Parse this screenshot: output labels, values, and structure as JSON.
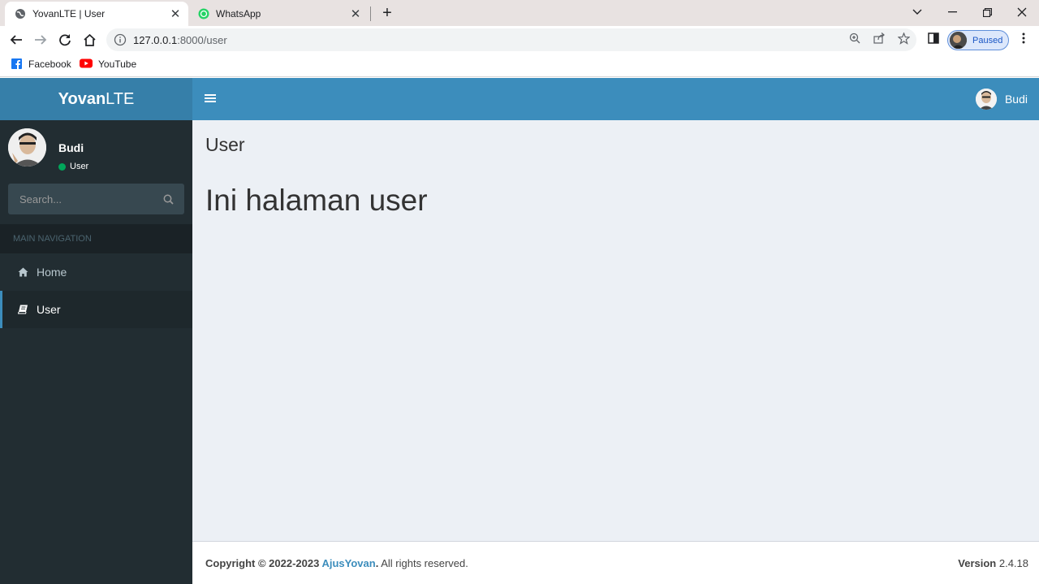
{
  "browser": {
    "tabs": [
      {
        "title": "YovanLTE | User",
        "icon": "globe-icon",
        "active": true
      },
      {
        "title": "WhatsApp",
        "icon": "whatsapp-icon",
        "active": false
      }
    ],
    "url_host": "127.0.0.1",
    "url_path": ":8000/user",
    "profile_label": "Paused",
    "bookmarks": [
      {
        "label": "Facebook",
        "icon": "facebook-icon"
      },
      {
        "label": "YouTube",
        "icon": "youtube-icon"
      }
    ]
  },
  "app": {
    "logo_bold": "Yovan",
    "logo_light": "LTE",
    "header_user": "Budi",
    "colors": {
      "header": "#3c8dbc",
      "logo_bg": "#367fa9",
      "sidebar": "#222d32",
      "content": "#ecf0f5",
      "online": "#00a65a"
    }
  },
  "sidebar": {
    "user_name": "Budi",
    "user_status": "User",
    "search_placeholder": "Search...",
    "nav_header": "MAIN NAVIGATION",
    "items": [
      {
        "label": "Home",
        "icon": "home-icon",
        "active": false
      },
      {
        "label": "User",
        "icon": "book-icon",
        "active": true
      }
    ]
  },
  "content": {
    "title": "User",
    "heading": "Ini halaman user"
  },
  "footer": {
    "copyright_prefix": "Copyright © 2022-2023 ",
    "author": "AjusYovan",
    "suffix": ". All rights reserved.",
    "version_label": "Version",
    "version_value": " 2.4.18"
  }
}
